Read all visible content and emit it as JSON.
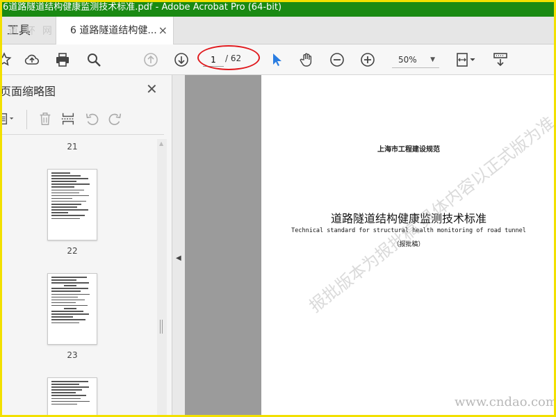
{
  "window": {
    "title": "6道路隧道结构健康监测技术标准.pdf - Adobe Acrobat Pro (64-bit)"
  },
  "tabs": {
    "tools_label": "工具",
    "document_tab_label": "6 道路隧道结构健...",
    "close_glyph": "×",
    "watermark_logo": "道 杯 网"
  },
  "toolbar": {
    "icons": [
      "star-icon",
      "upload-icon",
      "print-icon",
      "zoom-search-icon",
      "page-up-icon",
      "page-down-icon",
      "select-cursor-icon",
      "hand-tool-icon",
      "zoom-out-icon",
      "zoom-in-icon",
      "fit-page-icon",
      "scroll-mode-icon"
    ],
    "page_current": "1",
    "page_total": "/ 62",
    "zoom_value": "50%",
    "zoom_caret": "▼",
    "highlight_color": "#e0191d"
  },
  "thumbnails": {
    "title": "页面缩略图",
    "close_glyph": "✕",
    "icons": [
      "page-options-icon",
      "delete-icon",
      "insert-page-icon",
      "undo-icon",
      "redo-icon"
    ],
    "page_numbers": [
      "21",
      "22",
      "23"
    ]
  },
  "document": {
    "subtitle": "上海市工程建设规范",
    "title": "道路隧道结构健康监测技术标准",
    "english_title": "Technical standard for structural health monitoring of road tunnel",
    "note": "（报批稿）",
    "watermark": "报批版本为报批稿 具体内容以正式版为准",
    "site_watermark": "www.cndao.com"
  },
  "colors": {
    "title_bar": "#1a8a13",
    "frame": "#f2e000",
    "accent_cursor": "#2a7de1"
  }
}
